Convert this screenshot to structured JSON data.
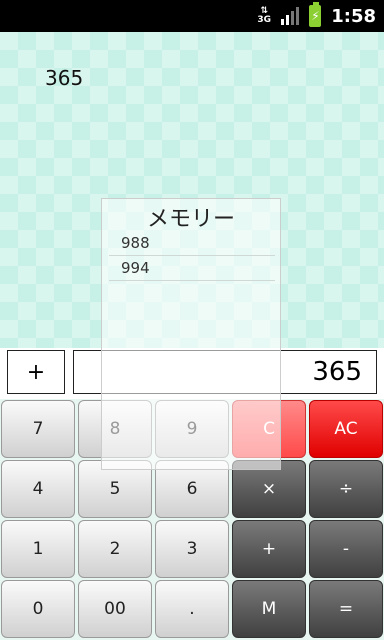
{
  "status_bar": {
    "network": "3G",
    "time": "1:58",
    "icons": [
      "data-arrows-icon",
      "signal-icon",
      "battery-charging-icon"
    ]
  },
  "display": {
    "value": "365"
  },
  "input_row": {
    "operator": "+",
    "value": "365"
  },
  "memory_panel": {
    "title": "メモリー",
    "items": [
      "988",
      "994"
    ]
  },
  "keypad": {
    "rows": [
      [
        "7",
        "8",
        "9",
        "C",
        "AC"
      ],
      [
        "4",
        "5",
        "6",
        "×",
        "÷"
      ],
      [
        "1",
        "2",
        "3",
        "+",
        "-"
      ],
      [
        "0",
        "00",
        ".",
        "M",
        "="
      ]
    ]
  },
  "colors": {
    "checker_light": "#d9f6ee",
    "checker_dark": "#c7f1e6",
    "ac_key": "#ff2020",
    "c_key": "#ff6b6b",
    "operator_key": "#555555"
  }
}
